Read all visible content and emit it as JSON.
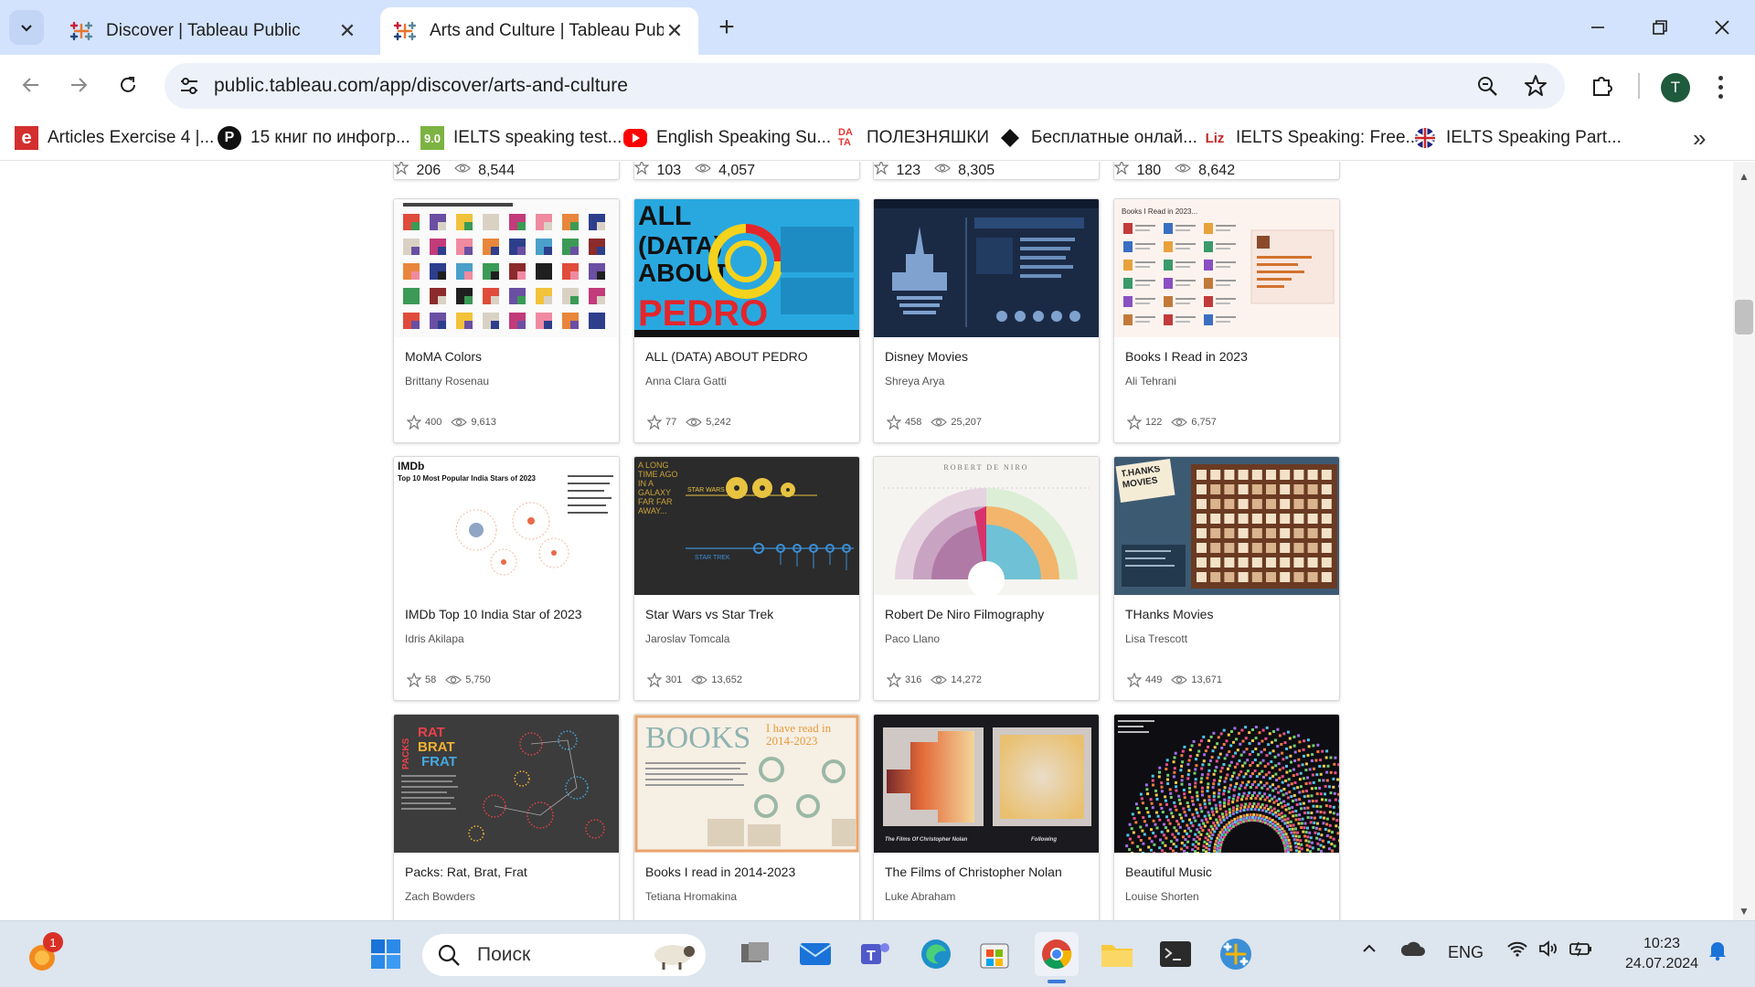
{
  "browser": {
    "tabs": [
      {
        "title": "Discover | Tableau Public",
        "active": false
      },
      {
        "title": "Arts and Culture | Tableau Public",
        "active": true
      }
    ],
    "new_tab_label": "+",
    "url": "public.tableau.com/app/discover/arts-and-culture",
    "profile_initial": "T"
  },
  "bookmarks": [
    {
      "label": "Articles Exercise 4 |...",
      "icon": "e-icon",
      "color": "#d32f2f"
    },
    {
      "label": "15 книг по инфогр...",
      "icon": "p-icon",
      "color": "#111111"
    },
    {
      "label": "IELTS speaking test...",
      "icon": "9.0-icon",
      "color": "#7cb342"
    },
    {
      "label": "English Speaking Su...",
      "icon": "youtube-icon",
      "color": "#ff0000"
    },
    {
      "label": "ПОЛЕЗНЯШКИ",
      "icon": "data-icon",
      "color": "#e53935"
    },
    {
      "label": "Бесплатные онлай...",
      "icon": "diamond-icon",
      "color": "#111111"
    },
    {
      "label": "IELTS Speaking: Free...",
      "icon": "liz-icon",
      "color": "#c62828"
    },
    {
      "label": "IELTS Speaking Part...",
      "icon": "uk-flag-icon",
      "color": "#1a237e"
    }
  ],
  "partial_row": [
    {
      "favorites": "206",
      "views": "8,544"
    },
    {
      "favorites": "103",
      "views": "4,057"
    },
    {
      "favorites": "123",
      "views": "8,305"
    },
    {
      "favorites": "180",
      "views": "8,642"
    }
  ],
  "cards": [
    {
      "title": "MoMA Colors",
      "author": "Brittany Rosenau",
      "favorites": "400",
      "views": "9,613",
      "thumb": "moma"
    },
    {
      "title": "ALL (DATA) ABOUT PEDRO",
      "author": "Anna Clara Gatti",
      "favorites": "77",
      "views": "5,242",
      "thumb": "pedro"
    },
    {
      "title": "Disney Movies",
      "author": "Shreya Arya",
      "favorites": "458",
      "views": "25,207",
      "thumb": "disney"
    },
    {
      "title": "Books I Read in 2023",
      "author": "Ali Tehrani",
      "favorites": "122",
      "views": "6,757",
      "thumb": "books2023"
    },
    {
      "title": "IMDb Top 10 India Star of 2023",
      "author": "Idris Akilapa",
      "favorites": "58",
      "views": "5,750",
      "thumb": "imdb"
    },
    {
      "title": "Star Wars vs Star Trek",
      "author": "Jaroslav Tomcala",
      "favorites": "301",
      "views": "13,652",
      "thumb": "starwars"
    },
    {
      "title": "Robert De Niro Filmography",
      "author": "Paco Llano",
      "favorites": "316",
      "views": "14,272",
      "thumb": "deniro"
    },
    {
      "title": "THanks Movies",
      "author": "Lisa Trescott",
      "favorites": "449",
      "views": "13,671",
      "thumb": "thanks"
    },
    {
      "title": "Packs: Rat, Brat, Frat",
      "author": "Zach Bowders",
      "favorites": "",
      "views": "",
      "thumb": "packs"
    },
    {
      "title": "Books I read in 2014-2023",
      "author": "Tetiana Hromakina",
      "favorites": "",
      "views": "",
      "thumb": "books1423"
    },
    {
      "title": "The Films of Christopher Nolan",
      "author": "Luke Abraham",
      "favorites": "",
      "views": "",
      "thumb": "nolan"
    },
    {
      "title": "Beautiful Music",
      "author": "Louise Shorten",
      "favorites": "",
      "views": "",
      "thumb": "music"
    }
  ],
  "thumb_text": {
    "pedro": "ALL (DATA) ABOUT PEDRO",
    "imdb_title": "IMDb",
    "imdb_sub": "Top 10 Most Popular India Stars of 2023",
    "starwars_side": "A LONG TIME AGO IN A GALAXY FAR FAR AWAY... BEFORE",
    "starwars_label1": "STAR WARS",
    "starwars_label2": "STAR TREK",
    "deniro": "ROBERT DE NIRO",
    "thanks": "T.HANKS MOVIES",
    "packs_a": "RAT",
    "packs_b": "BRAT",
    "packs_c": "FRAT",
    "packs_side": "PACKS",
    "books_big": "BOOKS",
    "books_small": "I have read in 2014-2023",
    "books2023": "Books I Read in 2023...",
    "nolan_caption": "The Films Of Christopher Nolan",
    "nolan_caption2": "Following"
  },
  "taskbar": {
    "search_placeholder": "Поиск",
    "notification_badge": "1",
    "language": "ENG",
    "time": "10:23",
    "date": "24.07.2024"
  }
}
